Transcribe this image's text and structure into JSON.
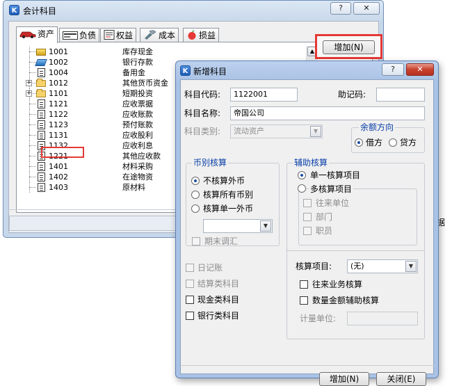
{
  "main_window": {
    "title": "会计科目",
    "help_btn": "?",
    "close_btn": "✕",
    "tabs": [
      {
        "label": "资产",
        "icon": "car-icon"
      },
      {
        "label": "负债",
        "icon": "card-icon"
      },
      {
        "label": "权益",
        "icon": "document-icon"
      },
      {
        "label": "成本",
        "icon": "tools-icon"
      },
      {
        "label": "损益",
        "icon": "apple-icon"
      }
    ],
    "add_button": "增加(N)",
    "accounts": [
      {
        "code": "1001",
        "name": "库存现金",
        "icon": "cash",
        "expandable": false
      },
      {
        "code": "1002",
        "name": "银行存款",
        "icon": "bank",
        "expandable": false
      },
      {
        "code": "1004",
        "name": "备用金",
        "icon": "doc",
        "expandable": false
      },
      {
        "code": "1012",
        "name": "其他货币资金",
        "icon": "folder",
        "expandable": true
      },
      {
        "code": "1101",
        "name": "短期投资",
        "icon": "folder",
        "expandable": true
      },
      {
        "code": "1121",
        "name": "应收票据",
        "icon": "doc",
        "expandable": false
      },
      {
        "code": "1122",
        "name": "应收账款",
        "icon": "doc",
        "expandable": false
      },
      {
        "code": "1123",
        "name": "预付账款",
        "icon": "doc",
        "expandable": false
      },
      {
        "code": "1131",
        "name": "应收股利",
        "icon": "doc",
        "expandable": false
      },
      {
        "code": "1132",
        "name": "应收利息",
        "icon": "doc",
        "expandable": false
      },
      {
        "code": "1221",
        "name": "其他应收款",
        "icon": "doc",
        "expandable": false
      },
      {
        "code": "1401",
        "name": "材料采购",
        "icon": "doc",
        "expandable": false
      },
      {
        "code": "1402",
        "name": "在途物资",
        "icon": "doc",
        "expandable": false
      },
      {
        "code": "1403",
        "name": "原材料",
        "icon": "doc",
        "expandable": false
      }
    ],
    "behind_text": "据"
  },
  "dialog": {
    "title": "新增科目",
    "help_btn": "?",
    "close_btn": "✕",
    "code_label": "科目代码:",
    "code_value": "1122001",
    "mnemonic_label": "助记码:",
    "mnemonic_value": "",
    "name_label": "科目名称:",
    "name_value": "帝国公司",
    "category_label": "科目类别:",
    "category_value": "流动资产",
    "balance_group": {
      "title": "余额方向",
      "debit": "借方",
      "credit": "贷方"
    },
    "currency_group": {
      "title": "币别核算",
      "opt_none": "不核算外币",
      "opt_all": "核算所有币别",
      "opt_single": "核算单一外币",
      "period_end": "期末调汇"
    },
    "aux_group": {
      "title": "辅助核算",
      "opt_single": "单一核算项目",
      "opt_multi": "多核算项目",
      "multi_items": [
        "往来单位",
        "部门",
        "职员"
      ]
    },
    "journal": "日记账",
    "settlement": "结算类科目",
    "cash_account": "现金类科目",
    "bank_account": "银行类科目",
    "audit_item_label": "核算项目:",
    "audit_item_value": "(无)",
    "ar_ap_audit": "往来业务核算",
    "qty_amount_aux": "数量金额辅助核算",
    "unit_label": "计量单位:",
    "add_button": "增加(N)",
    "close_button": "关闭(E)"
  },
  "colors": {
    "highlight_red": "#e53935",
    "title_blue": "#1c5cb8",
    "group_title": "#0a3fa8"
  }
}
